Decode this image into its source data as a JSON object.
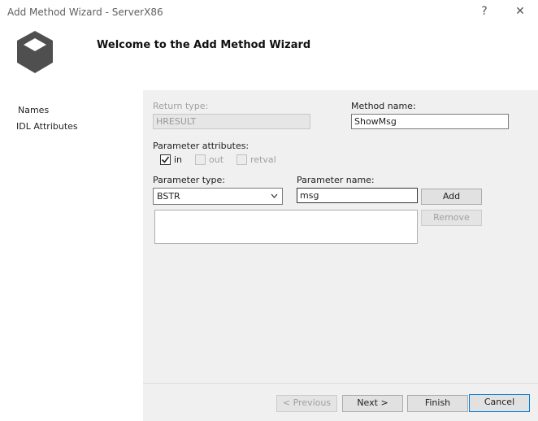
{
  "window": {
    "title": "Add Method Wizard - ServerX86",
    "help_label": "?",
    "close_label": "✕"
  },
  "header": {
    "title": "Welcome to the Add Method Wizard"
  },
  "nav": {
    "items": [
      {
        "label": "Names"
      },
      {
        "label": "IDL Attributes"
      }
    ]
  },
  "form": {
    "return_type": {
      "label": "Return type:",
      "value": "HRESULT"
    },
    "method_name": {
      "label": "Method name:",
      "value": "ShowMsg"
    },
    "parameter_attributes": {
      "label": "Parameter attributes:",
      "in": {
        "label": "in",
        "checked": true
      },
      "out": {
        "label": "out",
        "checked": false
      },
      "retval": {
        "label": "retval",
        "checked": false
      }
    },
    "parameter_type": {
      "label": "Parameter type:",
      "value": "BSTR"
    },
    "parameter_name": {
      "label": "Parameter name:",
      "value": "msg"
    },
    "add_label": "Add",
    "remove_label": "Remove"
  },
  "footer": {
    "previous_label": "< Previous",
    "next_label": "Next >",
    "finish_label": "Finish",
    "cancel_label": "Cancel"
  },
  "colors": {
    "pane_background": "#f0f0f0",
    "focus_border": "#0078d7",
    "logo_top": "#6e6e6e",
    "logo_side": "#4f4f4f"
  }
}
